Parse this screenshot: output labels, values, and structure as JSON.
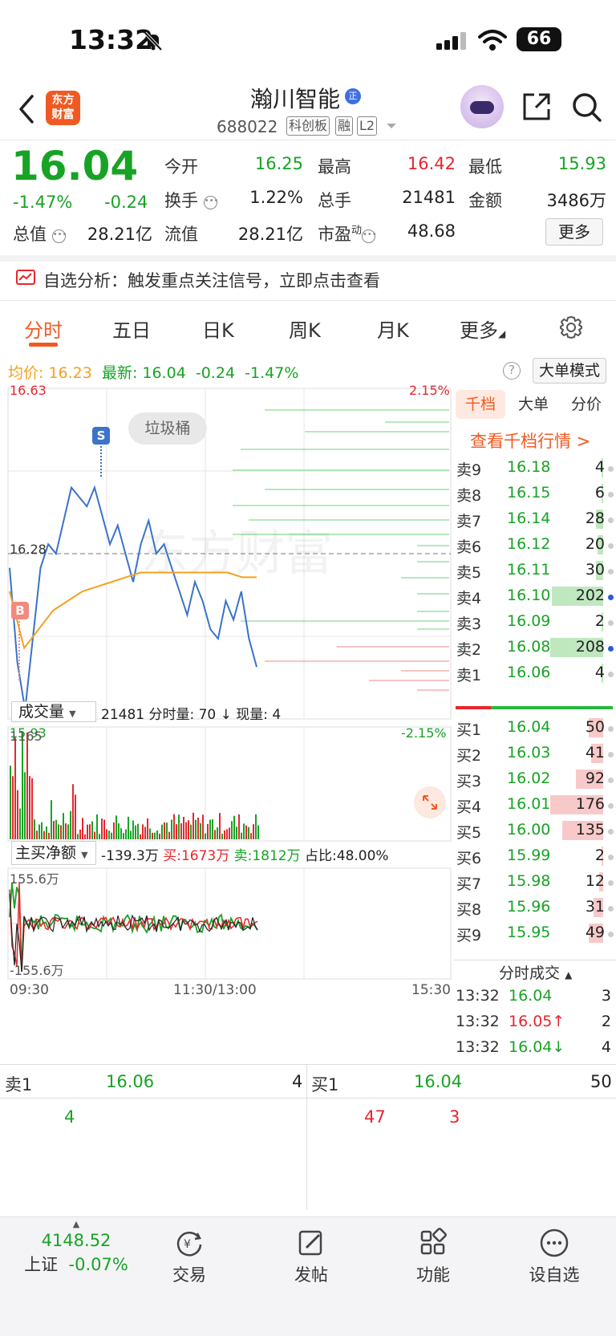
{
  "status_bar": {
    "time": "13:32",
    "battery": "66"
  },
  "header": {
    "stock_name": "瀚川智能",
    "zheng_badge": "正",
    "logo_line1": "东方",
    "logo_line2": "财富",
    "stock_code": "688022",
    "tags": [
      "科创板",
      "融",
      "L2"
    ]
  },
  "quote": {
    "price": "16.04",
    "change_pct": "-1.47%",
    "change": "-0.24",
    "open_label": "今开",
    "open": "16.25",
    "high_label": "最高",
    "high": "16.42",
    "low_label": "最低",
    "low": "15.93",
    "turnover_label": "换手",
    "turnover": "1.22%",
    "total_hands_label": "总手",
    "total_hands": "21481",
    "amount_label": "金额",
    "amount": "3486万",
    "market_value_label": "总值",
    "market_value": "28.21亿",
    "float_value_label": "流值",
    "float_value": "28.21亿",
    "pe_label": "市盈",
    "pe_sup": "动",
    "pe": "48.68",
    "more_button": "更多"
  },
  "analysis": {
    "text": "自选分析：触发重点关注信号，立即点击查看"
  },
  "tabs": [
    "分时",
    "五日",
    "日K",
    "周K",
    "月K",
    "更多"
  ],
  "infoline": {
    "avg_label": "均价:",
    "avg": "16.23",
    "latest_label": "最新:",
    "latest": "16.04",
    "change": "-0.24",
    "change_pct": "-1.47%",
    "help": "?",
    "bigmode_button": "大单模式"
  },
  "chart": {
    "y_max": "16.63",
    "y_mid": "16.28",
    "y_min": "15.93",
    "pct_max": "2.15%",
    "pct_min": "-2.15%",
    "trash_label": "垃圾桶",
    "marker_s": "S",
    "marker_b": "B",
    "watermark": "东方财富",
    "volume_selector": "成交量",
    "volume_info": "21481 分时量: 70 ↓ 现量: 4",
    "volume_max": "1165",
    "net_selector": "主买净额",
    "net_value": "-139.3万",
    "net_buy": "买:1673万",
    "net_sell": "卖:1812万",
    "net_ratio": "占比:48.00%",
    "net_max": "155.6万",
    "net_min": "-155.6万",
    "time_start": "09:30",
    "time_mid": "11:30/13:00",
    "time_end": "15:30"
  },
  "chart_data": {
    "type": "line",
    "x_range": [
      "09:30",
      "15:30"
    ],
    "ylim": [
      15.93,
      16.63
    ],
    "series": [
      {
        "values": [
          16.25,
          16.05,
          15.95,
          16.1,
          16.25,
          16.3,
          16.28,
          16.35,
          16.42,
          16.4,
          16.38,
          16.42,
          16.36,
          16.3,
          16.34,
          16.28,
          16.22,
          16.3,
          16.35,
          16.28,
          16.3,
          16.25,
          16.2,
          16.15,
          16.22,
          16.18,
          16.12,
          16.1,
          16.18,
          16.14,
          16.2,
          16.1,
          16.04
        ]
      },
      {
        "values": [
          16.2,
          16.08,
          16.12,
          16.16,
          16.18,
          16.2,
          16.21,
          16.22,
          16.23,
          16.24,
          16.24,
          16.24,
          16.24,
          16.24,
          16.24,
          16.24,
          16.23,
          16.23
        ]
      }
    ]
  },
  "orderbook": {
    "tabs": [
      "千档",
      "大单",
      "分价"
    ],
    "link": "查看千档行情 >",
    "asks": [
      {
        "label": "卖9",
        "price": "16.18",
        "vol": "4",
        "fill": 0.02
      },
      {
        "label": "卖8",
        "price": "16.15",
        "vol": "6",
        "fill": 0.03
      },
      {
        "label": "卖7",
        "price": "16.14",
        "vol": "28",
        "fill": 0.13
      },
      {
        "label": "卖6",
        "price": "16.12",
        "vol": "20",
        "fill": 0.1
      },
      {
        "label": "卖5",
        "price": "16.11",
        "vol": "30",
        "fill": 0.14
      },
      {
        "label": "卖4",
        "price": "16.10",
        "vol": "202",
        "fill": 0.97
      },
      {
        "label": "卖3",
        "price": "16.09",
        "vol": "2",
        "fill": 0.01
      },
      {
        "label": "卖2",
        "price": "16.08",
        "vol": "208",
        "fill": 1.0
      },
      {
        "label": "卖1",
        "price": "16.06",
        "vol": "4",
        "fill": 0.02
      }
    ],
    "bids": [
      {
        "label": "买1",
        "price": "16.04",
        "vol": "50",
        "fill": 0.28
      },
      {
        "label": "买2",
        "price": "16.03",
        "vol": "41",
        "fill": 0.23
      },
      {
        "label": "买3",
        "price": "16.02",
        "vol": "92",
        "fill": 0.52
      },
      {
        "label": "买4",
        "price": "16.01",
        "vol": "176",
        "fill": 1.0
      },
      {
        "label": "买5",
        "price": "16.00",
        "vol": "135",
        "fill": 0.77
      },
      {
        "label": "买6",
        "price": "15.99",
        "vol": "2",
        "fill": 0.01
      },
      {
        "label": "买7",
        "price": "15.98",
        "vol": "12",
        "fill": 0.07
      },
      {
        "label": "买8",
        "price": "15.96",
        "vol": "31",
        "fill": 0.18
      },
      {
        "label": "买9",
        "price": "15.95",
        "vol": "49",
        "fill": 0.28
      }
    ],
    "ticks_title": "分时成交",
    "ticks": [
      {
        "time": "13:32",
        "price": "16.04",
        "vol": "3"
      },
      {
        "time": "13:32",
        "price": "16.05↑",
        "vol": "2"
      },
      {
        "time": "13:32",
        "price": "16.04↓",
        "vol": "4"
      }
    ]
  },
  "bottom_quotes": {
    "sell_label": "卖1",
    "sell_price": "16.06",
    "sell_vol": "4",
    "sell_sub": "4",
    "buy_label": "买1",
    "buy_price": "16.04",
    "buy_vol": "50",
    "buy_sub_a": "47",
    "buy_sub_b": "3"
  },
  "bottom_bar": {
    "index_value": "4148.52",
    "index_name": "上证",
    "index_change": "-0.07%",
    "trade": "交易",
    "post": "发帖",
    "function": "功能",
    "watchlist": "设自选"
  },
  "colors": {
    "up": "#e8262d",
    "down": "#17a325",
    "accent": "#f05a22",
    "price_line": "#3a73c9",
    "avg_line": "#f5a020"
  }
}
